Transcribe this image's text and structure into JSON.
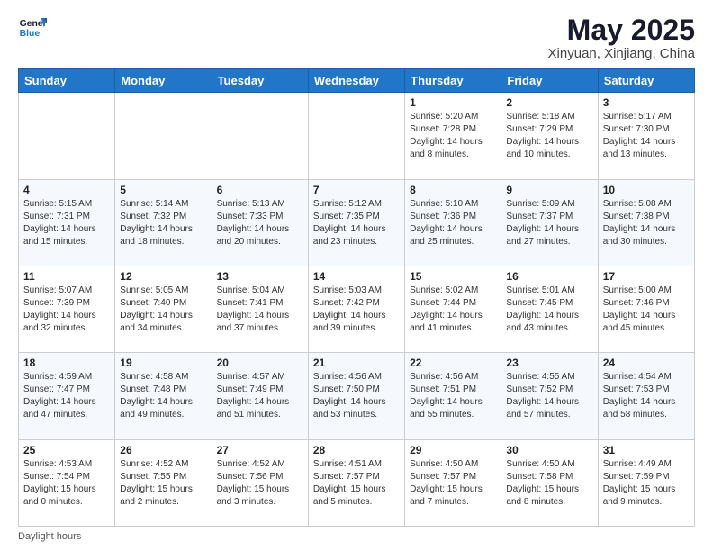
{
  "header": {
    "logo_line1": "General",
    "logo_line2": "Blue",
    "title": "May 2025",
    "subtitle": "Xinyuan, Xinjiang, China"
  },
  "columns": [
    "Sunday",
    "Monday",
    "Tuesday",
    "Wednesday",
    "Thursday",
    "Friday",
    "Saturday"
  ],
  "weeks": [
    [
      {
        "day": "",
        "content": ""
      },
      {
        "day": "",
        "content": ""
      },
      {
        "day": "",
        "content": ""
      },
      {
        "day": "",
        "content": ""
      },
      {
        "day": "1",
        "content": "Sunrise: 5:20 AM\nSunset: 7:28 PM\nDaylight: 14 hours\nand 8 minutes."
      },
      {
        "day": "2",
        "content": "Sunrise: 5:18 AM\nSunset: 7:29 PM\nDaylight: 14 hours\nand 10 minutes."
      },
      {
        "day": "3",
        "content": "Sunrise: 5:17 AM\nSunset: 7:30 PM\nDaylight: 14 hours\nand 13 minutes."
      }
    ],
    [
      {
        "day": "4",
        "content": "Sunrise: 5:15 AM\nSunset: 7:31 PM\nDaylight: 14 hours\nand 15 minutes."
      },
      {
        "day": "5",
        "content": "Sunrise: 5:14 AM\nSunset: 7:32 PM\nDaylight: 14 hours\nand 18 minutes."
      },
      {
        "day": "6",
        "content": "Sunrise: 5:13 AM\nSunset: 7:33 PM\nDaylight: 14 hours\nand 20 minutes."
      },
      {
        "day": "7",
        "content": "Sunrise: 5:12 AM\nSunset: 7:35 PM\nDaylight: 14 hours\nand 23 minutes."
      },
      {
        "day": "8",
        "content": "Sunrise: 5:10 AM\nSunset: 7:36 PM\nDaylight: 14 hours\nand 25 minutes."
      },
      {
        "day": "9",
        "content": "Sunrise: 5:09 AM\nSunset: 7:37 PM\nDaylight: 14 hours\nand 27 minutes."
      },
      {
        "day": "10",
        "content": "Sunrise: 5:08 AM\nSunset: 7:38 PM\nDaylight: 14 hours\nand 30 minutes."
      }
    ],
    [
      {
        "day": "11",
        "content": "Sunrise: 5:07 AM\nSunset: 7:39 PM\nDaylight: 14 hours\nand 32 minutes."
      },
      {
        "day": "12",
        "content": "Sunrise: 5:05 AM\nSunset: 7:40 PM\nDaylight: 14 hours\nand 34 minutes."
      },
      {
        "day": "13",
        "content": "Sunrise: 5:04 AM\nSunset: 7:41 PM\nDaylight: 14 hours\nand 37 minutes."
      },
      {
        "day": "14",
        "content": "Sunrise: 5:03 AM\nSunset: 7:42 PM\nDaylight: 14 hours\nand 39 minutes."
      },
      {
        "day": "15",
        "content": "Sunrise: 5:02 AM\nSunset: 7:44 PM\nDaylight: 14 hours\nand 41 minutes."
      },
      {
        "day": "16",
        "content": "Sunrise: 5:01 AM\nSunset: 7:45 PM\nDaylight: 14 hours\nand 43 minutes."
      },
      {
        "day": "17",
        "content": "Sunrise: 5:00 AM\nSunset: 7:46 PM\nDaylight: 14 hours\nand 45 minutes."
      }
    ],
    [
      {
        "day": "18",
        "content": "Sunrise: 4:59 AM\nSunset: 7:47 PM\nDaylight: 14 hours\nand 47 minutes."
      },
      {
        "day": "19",
        "content": "Sunrise: 4:58 AM\nSunset: 7:48 PM\nDaylight: 14 hours\nand 49 minutes."
      },
      {
        "day": "20",
        "content": "Sunrise: 4:57 AM\nSunset: 7:49 PM\nDaylight: 14 hours\nand 51 minutes."
      },
      {
        "day": "21",
        "content": "Sunrise: 4:56 AM\nSunset: 7:50 PM\nDaylight: 14 hours\nand 53 minutes."
      },
      {
        "day": "22",
        "content": "Sunrise: 4:56 AM\nSunset: 7:51 PM\nDaylight: 14 hours\nand 55 minutes."
      },
      {
        "day": "23",
        "content": "Sunrise: 4:55 AM\nSunset: 7:52 PM\nDaylight: 14 hours\nand 57 minutes."
      },
      {
        "day": "24",
        "content": "Sunrise: 4:54 AM\nSunset: 7:53 PM\nDaylight: 14 hours\nand 58 minutes."
      }
    ],
    [
      {
        "day": "25",
        "content": "Sunrise: 4:53 AM\nSunset: 7:54 PM\nDaylight: 15 hours\nand 0 minutes."
      },
      {
        "day": "26",
        "content": "Sunrise: 4:52 AM\nSunset: 7:55 PM\nDaylight: 15 hours\nand 2 minutes."
      },
      {
        "day": "27",
        "content": "Sunrise: 4:52 AM\nSunset: 7:56 PM\nDaylight: 15 hours\nand 3 minutes."
      },
      {
        "day": "28",
        "content": "Sunrise: 4:51 AM\nSunset: 7:57 PM\nDaylight: 15 hours\nand 5 minutes."
      },
      {
        "day": "29",
        "content": "Sunrise: 4:50 AM\nSunset: 7:57 PM\nDaylight: 15 hours\nand 7 minutes."
      },
      {
        "day": "30",
        "content": "Sunrise: 4:50 AM\nSunset: 7:58 PM\nDaylight: 15 hours\nand 8 minutes."
      },
      {
        "day": "31",
        "content": "Sunrise: 4:49 AM\nSunset: 7:59 PM\nDaylight: 15 hours\nand 9 minutes."
      }
    ]
  ],
  "footer": {
    "note": "Daylight hours"
  }
}
